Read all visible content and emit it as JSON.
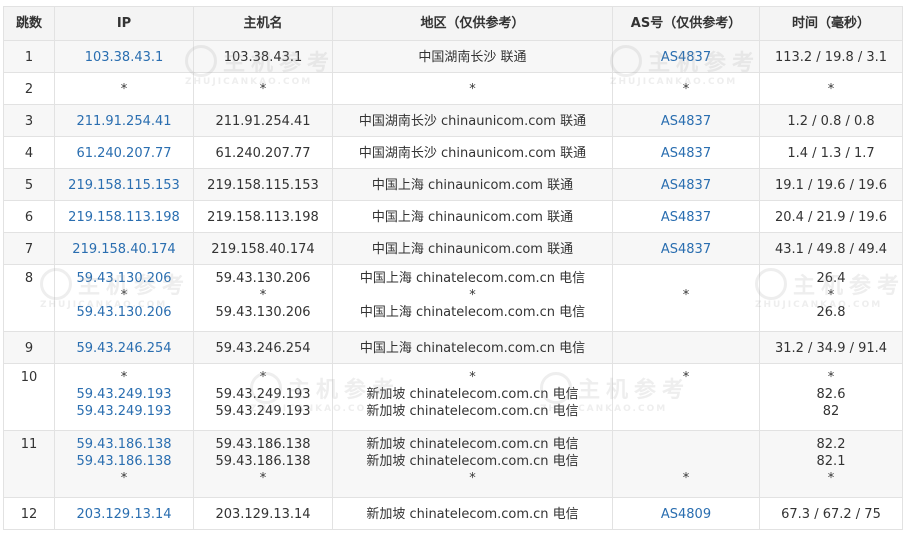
{
  "headers": [
    "跳数",
    "IP",
    "主机名",
    "地区（仅供参考）",
    "AS号（仅供参考）",
    "时间（毫秒）"
  ],
  "rows": [
    {
      "hop": "1",
      "ip": [
        "103.38.43.1"
      ],
      "host": [
        "103.38.43.1"
      ],
      "region": [
        "中国湖南长沙 联通"
      ],
      "as": [
        "AS4837"
      ],
      "time": [
        "113.2 / 19.8 / 3.1"
      ]
    },
    {
      "hop": "2",
      "ip": [
        "*"
      ],
      "host": [
        "*"
      ],
      "region": [
        "*"
      ],
      "as": [
        "*"
      ],
      "time": [
        "*"
      ]
    },
    {
      "hop": "3",
      "ip": [
        "211.91.254.41"
      ],
      "host": [
        "211.91.254.41"
      ],
      "region": [
        "中国湖南长沙 chinaunicom.com 联通"
      ],
      "as": [
        "AS4837"
      ],
      "time": [
        "1.2 / 0.8 / 0.8"
      ]
    },
    {
      "hop": "4",
      "ip": [
        "61.240.207.77"
      ],
      "host": [
        "61.240.207.77"
      ],
      "region": [
        "中国湖南长沙 chinaunicom.com 联通"
      ],
      "as": [
        "AS4837"
      ],
      "time": [
        "1.4 / 1.3 / 1.7"
      ]
    },
    {
      "hop": "5",
      "ip": [
        "219.158.115.153"
      ],
      "host": [
        "219.158.115.153"
      ],
      "region": [
        "中国上海 chinaunicom.com 联通"
      ],
      "as": [
        "AS4837"
      ],
      "time": [
        "19.1 / 19.6 / 19.6"
      ]
    },
    {
      "hop": "6",
      "ip": [
        "219.158.113.198"
      ],
      "host": [
        "219.158.113.198"
      ],
      "region": [
        "中国上海 chinaunicom.com 联通"
      ],
      "as": [
        "AS4837"
      ],
      "time": [
        "20.4 / 21.9 / 19.6"
      ]
    },
    {
      "hop": "7",
      "ip": [
        "219.158.40.174"
      ],
      "host": [
        "219.158.40.174"
      ],
      "region": [
        "中国上海 chinaunicom.com 联通"
      ],
      "as": [
        "AS4837"
      ],
      "time": [
        "43.1 / 49.8 / 49.4"
      ]
    },
    {
      "hop": "8",
      "ip": [
        "59.43.130.206",
        "*",
        "59.43.130.206"
      ],
      "host": [
        "59.43.130.206",
        "*",
        "59.43.130.206"
      ],
      "region": [
        "中国上海 chinatelecom.com.cn 电信",
        "*",
        "中国上海 chinatelecom.com.cn 电信"
      ],
      "as": [
        "",
        "*",
        ""
      ],
      "time": [
        "26.4",
        "*",
        "26.8"
      ]
    },
    {
      "hop": "9",
      "ip": [
        "59.43.246.254"
      ],
      "host": [
        "59.43.246.254"
      ],
      "region": [
        "中国上海 chinatelecom.com.cn 电信"
      ],
      "as": [
        ""
      ],
      "time": [
        "31.2 / 34.9 / 91.4"
      ]
    },
    {
      "hop": "10",
      "ip": [
        "*",
        "59.43.249.193",
        "59.43.249.193"
      ],
      "host": [
        "*",
        "59.43.249.193",
        "59.43.249.193"
      ],
      "region": [
        "*",
        "新加坡 chinatelecom.com.cn 电信",
        "新加坡 chinatelecom.com.cn 电信"
      ],
      "as": [
        "*",
        "",
        ""
      ],
      "time": [
        "*",
        "82.6",
        "82"
      ]
    },
    {
      "hop": "11",
      "ip": [
        "59.43.186.138",
        "59.43.186.138",
        "*"
      ],
      "host": [
        "59.43.186.138",
        "59.43.186.138",
        "*"
      ],
      "region": [
        "新加坡 chinatelecom.com.cn 电信",
        "新加坡 chinatelecom.com.cn 电信",
        "*"
      ],
      "as": [
        "",
        "",
        "*"
      ],
      "time": [
        "82.2",
        "82.1",
        "*"
      ]
    },
    {
      "hop": "12",
      "ip": [
        "203.129.13.14"
      ],
      "host": [
        "203.129.13.14"
      ],
      "region": [
        "新加坡 chinatelecom.com.cn 电信"
      ],
      "as": [
        "AS4809"
      ],
      "time": [
        "67.3 / 67.2 / 75"
      ]
    }
  ],
  "watermark": {
    "text": "主机参考",
    "subtext": "ZHUJICANKAO.COM"
  },
  "colors": {
    "link": "#2a6eb0",
    "header_bg": "#f4f4f4",
    "stripe_bg": "#f7f7f7",
    "border": "#e2e2e2"
  }
}
